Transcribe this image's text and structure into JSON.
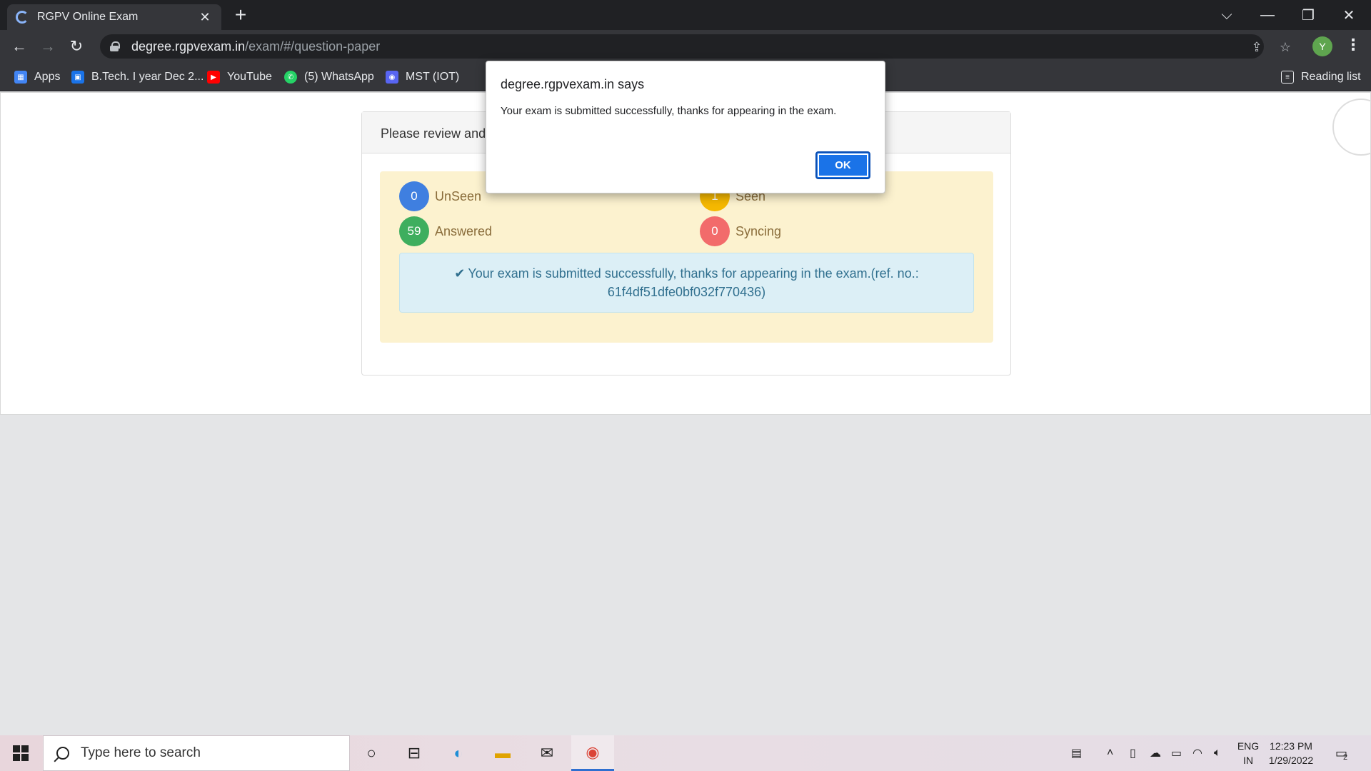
{
  "browser": {
    "tab_title": "RGPV Online Exam",
    "tab_close": "✕",
    "new_tab": "+",
    "url_host": "degree.rgpvexam.in",
    "url_path": "/exam/#/question-paper",
    "profile_initial": "Y",
    "window_controls": {
      "dropdown": "⌵",
      "minimize": "—",
      "restore": "❐",
      "close": "✕"
    },
    "bookmarks": [
      {
        "label": "Apps",
        "icon": "apps-grid-icon",
        "color": "#4285f4"
      },
      {
        "label": "B.Tech. I year Dec 2...",
        "icon": "contact-icon",
        "color": "#1a73e8"
      },
      {
        "label": "YouTube",
        "icon": "youtube-icon",
        "color": "#ff0000"
      },
      {
        "label": "(5) WhatsApp",
        "icon": "whatsapp-icon",
        "color": "#25d366"
      },
      {
        "label": "MST (IOT)",
        "icon": "discord-icon",
        "color": "#5865f2"
      }
    ],
    "reading_list": "Reading list"
  },
  "page": {
    "panel_header": "Please review and c",
    "stats": {
      "unseen": {
        "count": "0",
        "label": "UnSeen",
        "color": "#3f7fe0"
      },
      "seen": {
        "count": "1",
        "label": "Seen",
        "color": "#f5b800"
      },
      "answered": {
        "count": "59",
        "label": "Answered",
        "color": "#3eae5e"
      },
      "syncing": {
        "count": "0",
        "label": "Syncing",
        "color": "#f26b6b"
      }
    },
    "success_line1": "Your exam is submitted successfully, thanks for appearing in the exam.(ref. no.:",
    "success_line2": "61f4df51dfe0bf032f770436)"
  },
  "dialog": {
    "title": "degree.rgpvexam.in says",
    "message": "Your exam is submitted successfully, thanks for appearing in the exam.",
    "ok_label": "OK"
  },
  "taskbar": {
    "search_placeholder": "Type here to search",
    "lang_line1": "ENG",
    "lang_line2": "IN",
    "time": "12:23 PM",
    "date": "1/29/2022",
    "notification_count": "2"
  }
}
